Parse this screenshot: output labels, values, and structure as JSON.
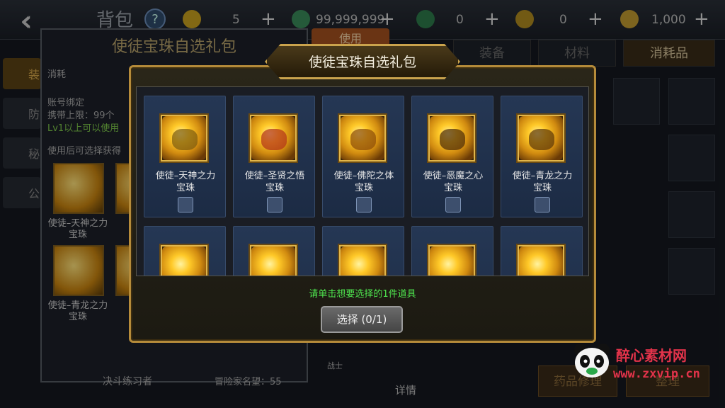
{
  "topbar": {
    "back_icon": "double-chevron-left-icon",
    "title": "背包",
    "help": "?",
    "resources": [
      {
        "icon": "coin-icon",
        "value": "5",
        "plus": "+",
        "color": "#c8a020"
      },
      {
        "icon": "green-gem-icon",
        "value": "99,999,999",
        "plus": "+",
        "color": "#3a8a5a"
      },
      {
        "icon": "green-potion-icon",
        "value": "0",
        "plus": "+",
        "color": "#2d7a4a"
      },
      {
        "icon": "gold-coin-icon",
        "value": "0",
        "plus": "+",
        "color": "#b08a20"
      },
      {
        "icon": "gold-ingot-icon",
        "value": "1,000",
        "plus": "+",
        "color": "#c09a30"
      }
    ]
  },
  "left_panel": {
    "title": "使徒宝珠自选礼包",
    "category": "消耗",
    "bind": "账号绑定",
    "carry_limit": "携带上限：99个",
    "level_req": "Lv1以上可以使用",
    "desc": "使用后可选择获得",
    "thumbs": [
      {
        "label": "使徒–天神之力宝珠"
      },
      {
        "label": "使徒–青龙之力宝珠"
      }
    ],
    "side_tabs": [
      "装",
      "防",
      "秘",
      "公"
    ],
    "footer_left": "决斗练习者",
    "footer_right": "冒险家名望：55"
  },
  "right_bg": {
    "use_label": "使用",
    "tabs": [
      "装备",
      "材料",
      "消耗品"
    ],
    "detail_label": "详情",
    "bottom_buttons": [
      "药品修理",
      "整理"
    ],
    "fighter_label": "战士"
  },
  "modal": {
    "title": "使徒宝珠自选礼包",
    "items": [
      {
        "label_line1": "使徒–天神之力",
        "label_line2": "宝珠",
        "checked": false
      },
      {
        "label_line1": "使徒–圣贤之悟",
        "label_line2": "宝珠",
        "checked": false
      },
      {
        "label_line1": "使徒–佛陀之体",
        "label_line2": "宝珠",
        "checked": false
      },
      {
        "label_line1": "使徒–恶魔之心",
        "label_line2": "宝珠",
        "checked": false
      },
      {
        "label_line1": "使徒–青龙之力",
        "label_line2": "宝珠",
        "checked": false
      }
    ],
    "second_row_count": 5,
    "hint": "请单击想要选择的1件道具",
    "select_label": "选择 (0/1)"
  },
  "watermark": {
    "text_cn": "醉心素材网",
    "url": "www.zxvip.cn"
  }
}
